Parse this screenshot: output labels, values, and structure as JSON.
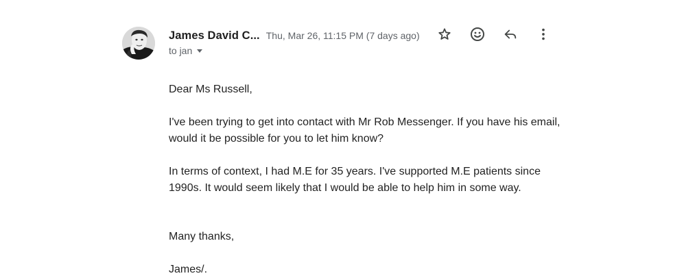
{
  "email": {
    "sender_name": "James David C...",
    "date": "Thu, Mar 26, 11:15 PM (7 days ago)",
    "recipient": "to jan",
    "actions": [
      "star-icon",
      "emoji-icon",
      "reply-icon",
      "more-vert-icon"
    ],
    "body": {
      "salutation": "Dear Ms Russell,",
      "paragraph1_line1": "I've been trying to get into contact with Mr Rob Messenger. If you have his email,",
      "paragraph1_line2": "would it be possible for you to let him know?",
      "paragraph2_line1": "In terms of context, I had M.E for 35 years. I've supported M.E patients since",
      "paragraph2_line2": "1990s. It would seem likely that I would be able to help him in some way.",
      "closing": "Many thanks,",
      "signature": "James/."
    }
  },
  "colors": {
    "icon": "#444746",
    "secondary_text": "#5f6368"
  }
}
